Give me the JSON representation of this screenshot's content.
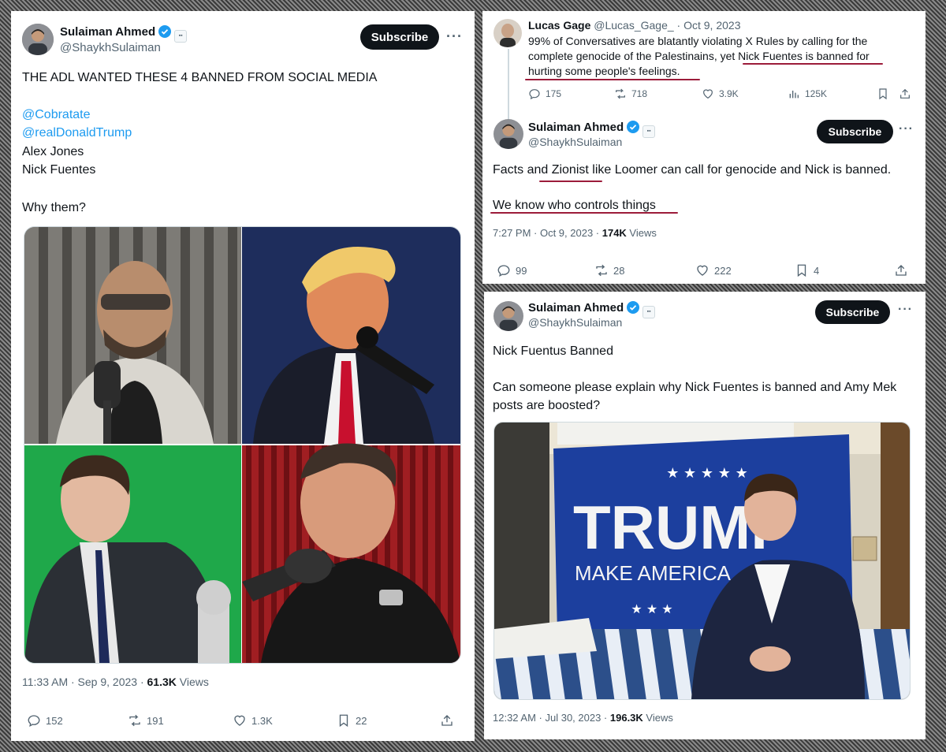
{
  "tweet1": {
    "author_name": "Sulaiman Ahmed",
    "author_handle": "@ShaykhSulaiman",
    "subscribe_label": "Subscribe",
    "more_label": "···",
    "text_line1": "THE ADL WANTED THESE 4 BANNED FROM SOCIAL MEDIA",
    "mention1": "@Cobratate",
    "mention2": "@realDonaldTrump",
    "line_alex": "Alex Jones",
    "line_nick": "Nick Fuentes",
    "question": "Why them?",
    "timestamp": "11:33 AM · Sep 9, 2023 · ",
    "views_count": "61.3K",
    "views_label": " Views",
    "replies": "152",
    "reposts": "191",
    "likes": "1.3K",
    "bookmarks": "22"
  },
  "tweet2": {
    "quoted_name": "Lucas Gage",
    "quoted_handle": "@Lucas_Gage_",
    "quoted_date": "· Oct 9, 2023",
    "quoted_line1": "99% of Conversatives are blatantly violating X Rules by calling for the",
    "quoted_line2": "complete genocide of the Palestinains, yet Nick Fuentes is banned for",
    "quoted_line3": "hurting some people's feelings.",
    "quoted_replies": "175",
    "quoted_reposts": "718",
    "quoted_likes": "3.9K",
    "quoted_views": "125K",
    "author_name": "Sulaiman Ahmed",
    "author_handle": "@ShaykhSulaiman",
    "subscribe_label": "Subscribe",
    "more_label": "···",
    "text_line1": "Facts and Zionist like Loomer can call for genocide and Nick is banned.",
    "text_line2": "We know who controls things",
    "timestamp": "7:27 PM · Oct 9, 2023 · ",
    "views_count": "174K",
    "views_label": " Views",
    "replies": "99",
    "reposts": "28",
    "likes": "222",
    "bookmarks": "4"
  },
  "tweet3": {
    "author_name": "Sulaiman Ahmed",
    "author_handle": "@ShaykhSulaiman",
    "subscribe_label": "Subscribe",
    "more_label": "···",
    "text_line1": "Nick Fuentus Banned",
    "text_line2": "Can someone please explain why Nick Fuentes is banned and Amy Mek",
    "text_line3": "posts are boosted?",
    "flag_word": "TRUMP",
    "flag_slogan": "MAKE AMERICA",
    "timestamp": "12:32 AM · Jul 30, 2023 · ",
    "views_count": "196.3K",
    "views_label": " Views"
  },
  "icons": [
    "verified-badge-icon",
    "affiliate-badge-icon",
    "reply-icon",
    "repost-icon",
    "like-icon",
    "bookmark-icon",
    "share-icon",
    "views-icon"
  ],
  "colors": {
    "accent": "#1d9bf0",
    "text": "#0f1419",
    "muted": "#536471",
    "annotation": "#9c1c3a"
  }
}
